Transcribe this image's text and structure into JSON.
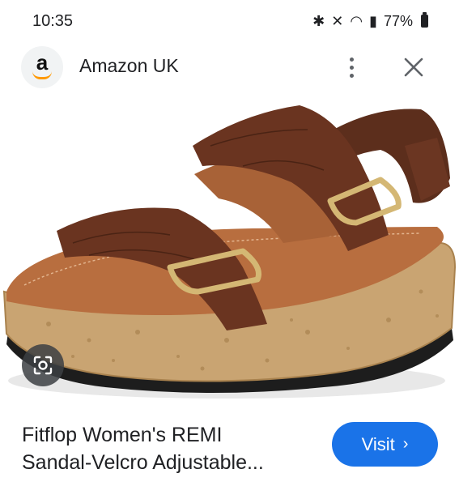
{
  "status_bar": {
    "time": "10:35",
    "battery": "77%",
    "icons": [
      "bluetooth-icon",
      "mute-icon",
      "wifi-icon",
      "signal-icon",
      "battery-icon"
    ]
  },
  "header": {
    "logo_letter": "a",
    "site_name": "Amazon UK",
    "more_icon": "more-vert-icon",
    "close_icon": "close-icon"
  },
  "product": {
    "title_line1": "Fitflop Women's REMI",
    "title_line2": "Sandal-Velcro Adjustable..."
  },
  "visit_button": {
    "label": "Visit",
    "icon": "chevron-right-icon"
  },
  "colors": {
    "accent": "#1a73e8",
    "brand": "#ff9900"
  }
}
